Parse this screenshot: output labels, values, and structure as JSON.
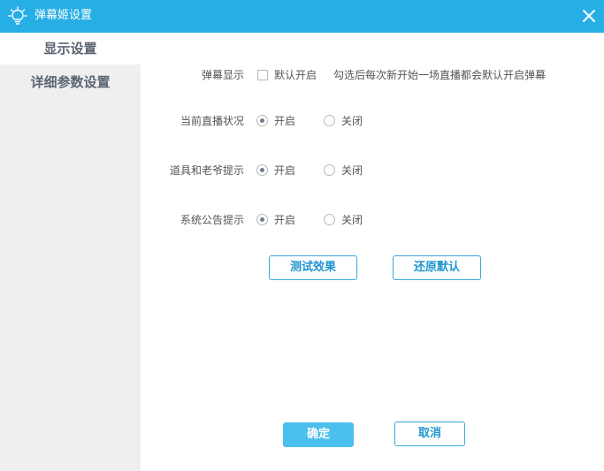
{
  "window": {
    "title": "弹幕姬设置",
    "icon": "lightbulb-icon",
    "close_icon": "close-icon",
    "accent": "#26aee5"
  },
  "sidebar": {
    "items": [
      {
        "label": "显示设置",
        "active": true
      },
      {
        "label": "详细参数设置",
        "active": false
      }
    ]
  },
  "settings": {
    "danmaku_display": {
      "label": "弹幕显示",
      "checkbox_label": "默认开启",
      "checked": false,
      "hint": "勾选后每次新开始一场直播都会默认开启弹幕"
    },
    "live_status": {
      "label": "当前直播状况",
      "on_label": "开启",
      "off_label": "关闭",
      "selected": "on"
    },
    "gift_tip": {
      "label": "道具和老爷提示",
      "on_label": "开启",
      "off_label": "关闭",
      "selected": "on"
    },
    "announcement": {
      "label": "系统公告提示",
      "on_label": "开启",
      "off_label": "关闭",
      "selected": "on"
    }
  },
  "actions": {
    "test_label": "测试效果",
    "restore_label": "还原默认"
  },
  "footer": {
    "confirm_label": "确定",
    "cancel_label": "取消"
  }
}
